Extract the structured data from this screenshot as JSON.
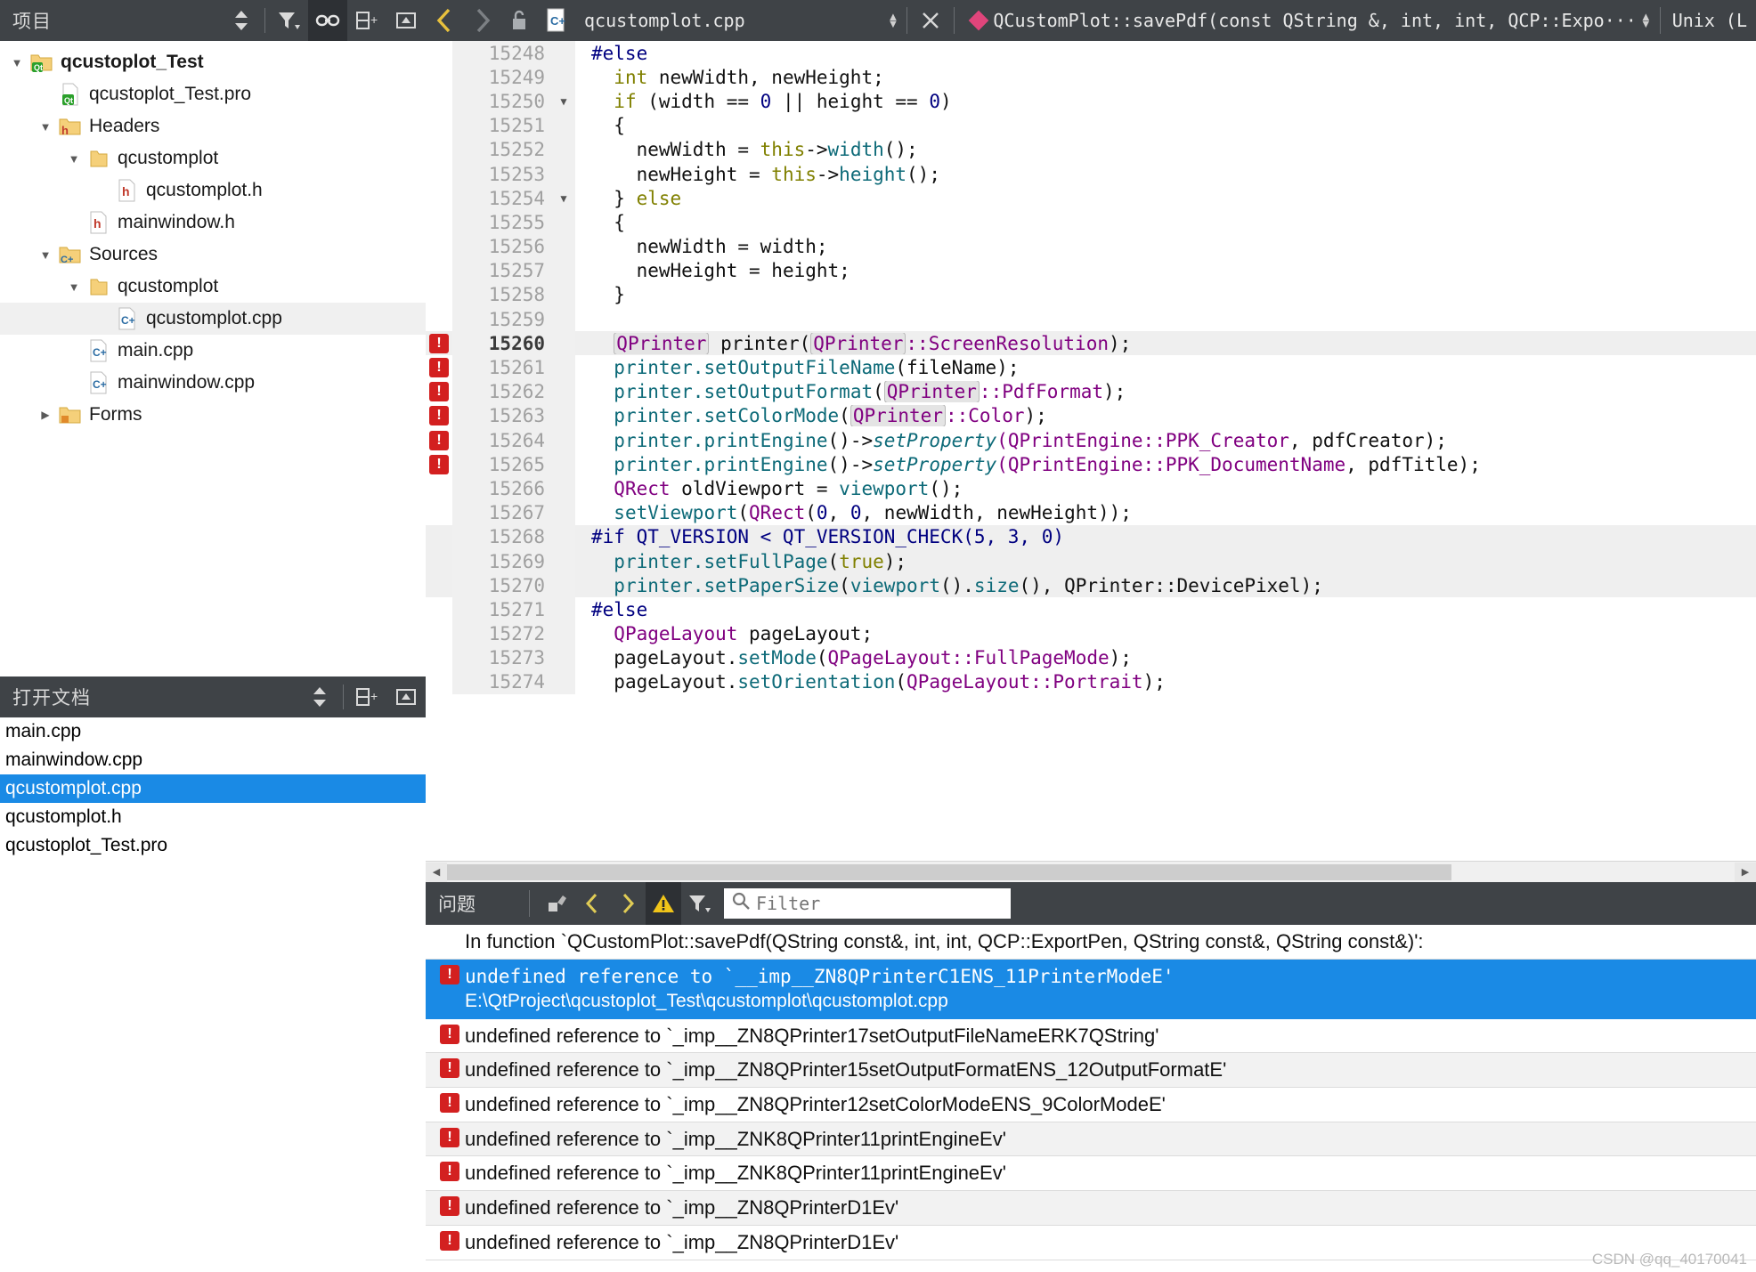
{
  "project_panel": {
    "title": "项目",
    "tools": [
      {
        "name": "sync-arrows-icon",
        "glyph": "⇕"
      },
      {
        "name": "filter-icon",
        "glyph": "filter"
      },
      {
        "name": "link-icon",
        "glyph": "link",
        "active": true
      },
      {
        "name": "split-add-icon",
        "glyph": "split"
      },
      {
        "name": "collapse-icon",
        "glyph": "collapse"
      }
    ],
    "tree": [
      {
        "label": "qcustoplot_Test",
        "indent": 0,
        "arrow": "down",
        "icon": "qt-project-folder",
        "bold": true
      },
      {
        "label": "qcustoplot_Test.pro",
        "indent": 1,
        "arrow": "none",
        "icon": "qt-pro-file",
        "bold": false
      },
      {
        "label": "Headers",
        "indent": 1,
        "arrow": "down",
        "icon": "folder-h",
        "bold": false
      },
      {
        "label": "qcustomplot",
        "indent": 2,
        "arrow": "down",
        "icon": "folder",
        "bold": false
      },
      {
        "label": "qcustomplot.h",
        "indent": 3,
        "arrow": "none",
        "icon": "h-file",
        "bold": false
      },
      {
        "label": "mainwindow.h",
        "indent": 2,
        "arrow": "none",
        "icon": "h-file",
        "bold": false
      },
      {
        "label": "Sources",
        "indent": 1,
        "arrow": "down",
        "icon": "folder-cpp",
        "bold": false
      },
      {
        "label": "qcustomplot",
        "indent": 2,
        "arrow": "down",
        "icon": "folder",
        "bold": false
      },
      {
        "label": "qcustomplot.cpp",
        "indent": 3,
        "arrow": "none",
        "icon": "cpp-file",
        "bold": false,
        "highlight": true
      },
      {
        "label": "main.cpp",
        "indent": 2,
        "arrow": "none",
        "icon": "cpp-file",
        "bold": false
      },
      {
        "label": "mainwindow.cpp",
        "indent": 2,
        "arrow": "none",
        "icon": "cpp-file",
        "bold": false
      },
      {
        "label": "Forms",
        "indent": 1,
        "arrow": "right",
        "icon": "folder-ui",
        "bold": false
      }
    ]
  },
  "open_documents": {
    "title": "打开文档",
    "tools": [
      {
        "name": "sync-arrows-icon",
        "glyph": "⇕"
      },
      {
        "name": "split-add-icon",
        "glyph": "split"
      },
      {
        "name": "collapse-icon",
        "glyph": "collapse"
      }
    ],
    "items": [
      {
        "label": "main.cpp",
        "selected": false
      },
      {
        "label": "mainwindow.cpp",
        "selected": false
      },
      {
        "label": "qcustomplot.cpp",
        "selected": true
      },
      {
        "label": "qcustomplot.h",
        "selected": false
      },
      {
        "label": "qcustoplot_Test.pro",
        "selected": false
      }
    ]
  },
  "editor_toolbar": {
    "back_icon": "chevron-left-icon",
    "forward_icon": "chevron-right-icon",
    "lock_icon": "unlocked-icon",
    "file_icon": "cpp-file-icon",
    "filename": "qcustomplot.cpp",
    "close_icon": "close-icon",
    "symbol": "QCustomPlot::savePdf(const QString &, int, int, QCP::Expo···",
    "line_ending": "Unix (L"
  },
  "code": {
    "first_line_number": 15248,
    "lines": [
      {
        "num": 15248,
        "fold": "",
        "err": false,
        "hl": false,
        "tokens": [
          {
            "t": "#else",
            "c": "pp"
          }
        ],
        "indent": 0
      },
      {
        "num": 15249,
        "fold": "",
        "err": false,
        "hl": false,
        "tokens": [
          {
            "t": "int",
            "c": "k"
          },
          {
            "t": " newWidth, newHeight;",
            "c": "pl"
          }
        ],
        "indent": 1
      },
      {
        "num": 15250,
        "fold": "▼",
        "err": false,
        "hl": false,
        "tokens": [
          {
            "t": "if",
            "c": "k"
          },
          {
            "t": " (width == ",
            "c": "pl"
          },
          {
            "t": "0",
            "c": "nu"
          },
          {
            "t": " || height == ",
            "c": "pl"
          },
          {
            "t": "0",
            "c": "nu"
          },
          {
            "t": ")",
            "c": "pl"
          }
        ],
        "indent": 1
      },
      {
        "num": 15251,
        "fold": "",
        "err": false,
        "hl": false,
        "tokens": [
          {
            "t": "{",
            "c": "pl"
          }
        ],
        "indent": 1
      },
      {
        "num": 15252,
        "fold": "",
        "err": false,
        "hl": false,
        "tokens": [
          {
            "t": "newWidth = ",
            "c": "pl"
          },
          {
            "t": "this",
            "c": "k"
          },
          {
            "t": "->",
            "c": "pl"
          },
          {
            "t": "width",
            "c": "fn"
          },
          {
            "t": "();",
            "c": "pl"
          }
        ],
        "indent": 2
      },
      {
        "num": 15253,
        "fold": "",
        "err": false,
        "hl": false,
        "tokens": [
          {
            "t": "newHeight = ",
            "c": "pl"
          },
          {
            "t": "this",
            "c": "k"
          },
          {
            "t": "->",
            "c": "pl"
          },
          {
            "t": "height",
            "c": "fn"
          },
          {
            "t": "();",
            "c": "pl"
          }
        ],
        "indent": 2
      },
      {
        "num": 15254,
        "fold": "▼",
        "err": false,
        "hl": false,
        "tokens": [
          {
            "t": "} ",
            "c": "pl"
          },
          {
            "t": "else",
            "c": "k"
          }
        ],
        "indent": 1
      },
      {
        "num": 15255,
        "fold": "",
        "err": false,
        "hl": false,
        "tokens": [
          {
            "t": "{",
            "c": "pl"
          }
        ],
        "indent": 1
      },
      {
        "num": 15256,
        "fold": "",
        "err": false,
        "hl": false,
        "tokens": [
          {
            "t": "newWidth = width;",
            "c": "pl"
          }
        ],
        "indent": 2
      },
      {
        "num": 15257,
        "fold": "",
        "err": false,
        "hl": false,
        "tokens": [
          {
            "t": "newHeight = height;",
            "c": "pl"
          }
        ],
        "indent": 2
      },
      {
        "num": 15258,
        "fold": "",
        "err": false,
        "hl": false,
        "tokens": [
          {
            "t": "}",
            "c": "pl"
          }
        ],
        "indent": 1
      },
      {
        "num": 15259,
        "fold": "",
        "err": false,
        "hl": false,
        "tokens": [],
        "indent": 0
      },
      {
        "num": 15260,
        "fold": "",
        "err": true,
        "hl": true,
        "current": true,
        "tokens": [
          {
            "t": "QPrinter",
            "c": "chip"
          },
          {
            "t": " printer(",
            "c": "pl"
          },
          {
            "t": "QPrinter",
            "c": "chip"
          },
          {
            "t": "::ScreenResolution",
            "c": "ty"
          },
          {
            "t": ");",
            "c": "pl"
          }
        ],
        "indent": 1
      },
      {
        "num": 15261,
        "fold": "",
        "err": true,
        "hl": false,
        "tokens": [
          {
            "t": "printer.",
            "c": "fn"
          },
          {
            "t": "setOutputFileName",
            "c": "fn"
          },
          {
            "t": "(fileName);",
            "c": "pl"
          }
        ],
        "indent": 1
      },
      {
        "num": 15262,
        "fold": "",
        "err": true,
        "hl": false,
        "tokens": [
          {
            "t": "printer.",
            "c": "fn"
          },
          {
            "t": "setOutputFormat",
            "c": "fn"
          },
          {
            "t": "(",
            "c": "pl"
          },
          {
            "t": "QPrinter",
            "c": "chip"
          },
          {
            "t": "::PdfFormat",
            "c": "ty"
          },
          {
            "t": ");",
            "c": "pl"
          }
        ],
        "indent": 1
      },
      {
        "num": 15263,
        "fold": "",
        "err": true,
        "hl": false,
        "tokens": [
          {
            "t": "printer.",
            "c": "fn"
          },
          {
            "t": "setColorMode",
            "c": "fn"
          },
          {
            "t": "(",
            "c": "pl"
          },
          {
            "t": "QPrinter",
            "c": "chip"
          },
          {
            "t": "::Color",
            "c": "ty"
          },
          {
            "t": ");",
            "c": "pl"
          }
        ],
        "indent": 1
      },
      {
        "num": 15264,
        "fold": "",
        "err": true,
        "hl": false,
        "tokens": [
          {
            "t": "printer.",
            "c": "fn"
          },
          {
            "t": "printEngine",
            "c": "fn"
          },
          {
            "t": "()->",
            "c": "pl"
          },
          {
            "t": "setProperty",
            "c": "fni"
          },
          {
            "t": "(QPrintEngine::PPK_Creator",
            "c": "ty"
          },
          {
            "t": ", pdfCreator);",
            "c": "pl"
          }
        ],
        "indent": 1
      },
      {
        "num": 15265,
        "fold": "",
        "err": true,
        "hl": false,
        "tokens": [
          {
            "t": "printer.",
            "c": "fn"
          },
          {
            "t": "printEngine",
            "c": "fn"
          },
          {
            "t": "()->",
            "c": "pl"
          },
          {
            "t": "setProperty",
            "c": "fni"
          },
          {
            "t": "(QPrintEngine::PPK_DocumentName",
            "c": "ty"
          },
          {
            "t": ", pdfTitle);",
            "c": "pl"
          }
        ],
        "indent": 1
      },
      {
        "num": 15266,
        "fold": "",
        "err": false,
        "hl": false,
        "tokens": [
          {
            "t": "QRect",
            "c": "ty"
          },
          {
            "t": " oldViewport = ",
            "c": "pl"
          },
          {
            "t": "viewport",
            "c": "fn"
          },
          {
            "t": "();",
            "c": "pl"
          }
        ],
        "indent": 1
      },
      {
        "num": 15267,
        "fold": "",
        "err": false,
        "hl": false,
        "tokens": [
          {
            "t": "setViewport",
            "c": "fn"
          },
          {
            "t": "(",
            "c": "pl"
          },
          {
            "t": "QRect",
            "c": "ty"
          },
          {
            "t": "(",
            "c": "pl"
          },
          {
            "t": "0",
            "c": "nu"
          },
          {
            "t": ", ",
            "c": "pl"
          },
          {
            "t": "0",
            "c": "nu"
          },
          {
            "t": ", newWidth, newHeight));",
            "c": "pl"
          }
        ],
        "indent": 1
      },
      {
        "num": 15268,
        "fold": "",
        "err": false,
        "hl": true,
        "tokens": [
          {
            "t": "#if QT_VERSION < QT_VERSION_CHECK(5, 3, 0)",
            "c": "pp"
          }
        ],
        "indent": 0
      },
      {
        "num": 15269,
        "fold": "",
        "err": false,
        "hl": true,
        "tokens": [
          {
            "t": "printer.",
            "c": "fn"
          },
          {
            "t": "setFullPage",
            "c": "fn"
          },
          {
            "t": "(",
            "c": "pl"
          },
          {
            "t": "true",
            "c": "k"
          },
          {
            "t": ");",
            "c": "pl"
          }
        ],
        "indent": 1
      },
      {
        "num": 15270,
        "fold": "",
        "err": false,
        "hl": true,
        "tokens": [
          {
            "t": "printer.",
            "c": "fn"
          },
          {
            "t": "setPaperSize",
            "c": "fn"
          },
          {
            "t": "(",
            "c": "pl"
          },
          {
            "t": "viewport",
            "c": "fn"
          },
          {
            "t": "().",
            "c": "pl"
          },
          {
            "t": "size",
            "c": "fn"
          },
          {
            "t": "(), QPrinter::DevicePixel",
            "c": "pl"
          },
          {
            "t": ");",
            "c": "pl"
          }
        ],
        "indent": 1
      },
      {
        "num": 15271,
        "fold": "",
        "err": false,
        "hl": false,
        "tokens": [
          {
            "t": "#else",
            "c": "pp"
          }
        ],
        "indent": 0
      },
      {
        "num": 15272,
        "fold": "",
        "err": false,
        "hl": false,
        "tokens": [
          {
            "t": "QPageLayout",
            "c": "ty"
          },
          {
            "t": " pageLayout;",
            "c": "pl"
          }
        ],
        "indent": 1
      },
      {
        "num": 15273,
        "fold": "",
        "err": false,
        "hl": false,
        "tokens": [
          {
            "t": "pageLayout.",
            "c": "pl"
          },
          {
            "t": "setMode",
            "c": "fn"
          },
          {
            "t": "(",
            "c": "pl"
          },
          {
            "t": "QPageLayout::FullPageMode",
            "c": "ty"
          },
          {
            "t": ");",
            "c": "pl"
          }
        ],
        "indent": 1
      },
      {
        "num": 15274,
        "fold": "",
        "err": false,
        "hl": false,
        "tokens": [
          {
            "t": "pageLayout.",
            "c": "pl"
          },
          {
            "t": "setOrientation",
            "c": "fn"
          },
          {
            "t": "(",
            "c": "pl"
          },
          {
            "t": "QPageLayout::Portrait",
            "c": "ty"
          },
          {
            "t": ");",
            "c": "pl"
          }
        ],
        "indent": 1
      }
    ]
  },
  "issues_panel": {
    "title": "问题",
    "tools": [
      {
        "name": "clear-icon",
        "glyph": "clear"
      },
      {
        "name": "prev-issue-icon",
        "glyph": "‹"
      },
      {
        "name": "next-issue-icon",
        "glyph": "›"
      },
      {
        "name": "warning-filter-icon",
        "glyph": "!",
        "active": true
      },
      {
        "name": "filter-icon",
        "glyph": "filter"
      }
    ],
    "search_placeholder": "Filter",
    "search_value": "",
    "search_icon": "search-icon",
    "rows": [
      {
        "kind": "header",
        "text": "In function `QCustomPlot::savePdf(QString const&, int, int, QCP::ExportPen, QString const&, QString const&)':",
        "selected": false,
        "alt": false
      },
      {
        "kind": "error",
        "text": "undefined reference to `__imp__ZN8QPrinterC1ENS_11PrinterModeE'",
        "path": "E:\\QtProject\\qcustoplot_Test\\qcustomplot\\qcustomplot.cpp",
        "selected": true,
        "alt": false
      },
      {
        "kind": "error",
        "text": "undefined reference to `_imp__ZN8QPrinter17setOutputFileNameERK7QString'",
        "path": "",
        "selected": false,
        "alt": false
      },
      {
        "kind": "error",
        "text": "undefined reference to `_imp__ZN8QPrinter15setOutputFormatENS_12OutputFormatE'",
        "path": "",
        "selected": false,
        "alt": true
      },
      {
        "kind": "error",
        "text": "undefined reference to `_imp__ZN8QPrinter12setColorModeENS_9ColorModeE'",
        "path": "",
        "selected": false,
        "alt": false
      },
      {
        "kind": "error",
        "text": "undefined reference to `_imp__ZNK8QPrinter11printEngineEv'",
        "path": "",
        "selected": false,
        "alt": true
      },
      {
        "kind": "error",
        "text": "undefined reference to `_imp__ZNK8QPrinter11printEngineEv'",
        "path": "",
        "selected": false,
        "alt": false
      },
      {
        "kind": "error",
        "text": "undefined reference to `_imp__ZN8QPrinterD1Ev'",
        "path": "",
        "selected": false,
        "alt": true
      },
      {
        "kind": "error",
        "text": "undefined reference to `_imp__ZN8QPrinterD1Ev'",
        "path": "",
        "selected": false,
        "alt": false
      }
    ]
  },
  "watermark": "CSDN @qq_40170041",
  "colors": {
    "toolbar_bg": "#3f4347",
    "selection_blue": "#1a8ae5",
    "error_red": "#d32020",
    "accent_pink": "#e0457b",
    "warn_yellow": "#e0cc55"
  }
}
